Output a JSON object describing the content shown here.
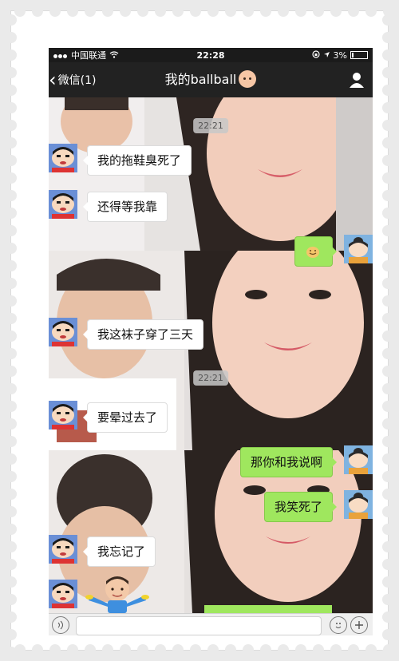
{
  "status_bar": {
    "carrier": "中国联通",
    "time": "22:28",
    "battery": "3%"
  },
  "nav": {
    "back_label": "微信(1)",
    "title": "我的ballball"
  },
  "messages": [
    {
      "type": "timestamp",
      "text": "22:21"
    },
    {
      "type": "in",
      "sender_avatar": "crayon-shinchan-avatar",
      "text": "我的拖鞋臭死了"
    },
    {
      "type": "in",
      "sender_avatar": "crayon-shinchan-avatar",
      "text": "还得等我靠"
    },
    {
      "type": "out",
      "sender_avatar": "cartoon-girl-avatar",
      "sticker": "smiling-face-sticker"
    },
    {
      "type": "in",
      "sender_avatar": "crayon-shinchan-avatar",
      "text": "我这袜子穿了三天"
    },
    {
      "type": "timestamp",
      "text": "22:21"
    },
    {
      "type": "in",
      "sender_avatar": "crayon-shinchan-avatar",
      "text": "要晕过去了"
    },
    {
      "type": "out",
      "sender_avatar": "cartoon-girl-avatar",
      "text": "那你和我说啊"
    },
    {
      "type": "out",
      "sender_avatar": "cartoon-girl-avatar",
      "text": "我笑死了"
    },
    {
      "type": "in",
      "sender_avatar": "crayon-shinchan-avatar",
      "text": "我忘记了"
    },
    {
      "type": "in",
      "sender_avatar": "crayon-shinchan-avatar",
      "sticker": "baby-shrug-sticker"
    }
  ],
  "colors": {
    "outgoing_bubble": "#9fe75e",
    "incoming_bubble": "#ffffff",
    "nav_background": "#222222"
  }
}
